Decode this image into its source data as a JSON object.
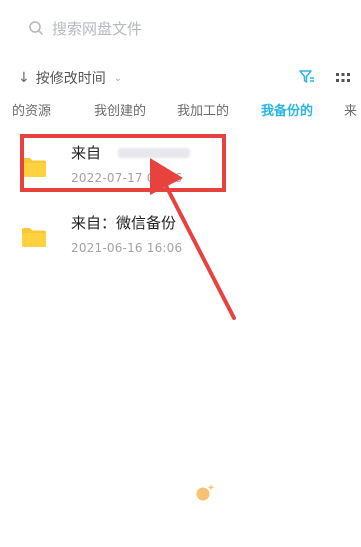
{
  "search": {
    "placeholder": "搜索网盘文件",
    "icon": "search-icon"
  },
  "toolbar": {
    "sort_arrow": "↓",
    "sort_label": "按修改时间",
    "sort_chevron": "⌄",
    "filter_icon": "filter-icon",
    "view_icon": "grid-view-icon",
    "accent_color": "#2bb5e6"
  },
  "tabs": [
    {
      "label": "的资源",
      "active": false
    },
    {
      "label": "我创建的",
      "active": false
    },
    {
      "label": "我加工的",
      "active": false
    },
    {
      "label": "我备份的",
      "active": true
    },
    {
      "label": "来",
      "active": false
    }
  ],
  "files": [
    {
      "title": "来自",
      "date": "2022-07-17  09:56",
      "icon": "folder-icon",
      "highlighted": true
    },
    {
      "title": "来自：微信备份",
      "date": "2021-06-16  16:06",
      "icon": "folder-icon",
      "highlighted": false
    }
  ],
  "annotation": {
    "highlight_color": "#e8423f"
  }
}
